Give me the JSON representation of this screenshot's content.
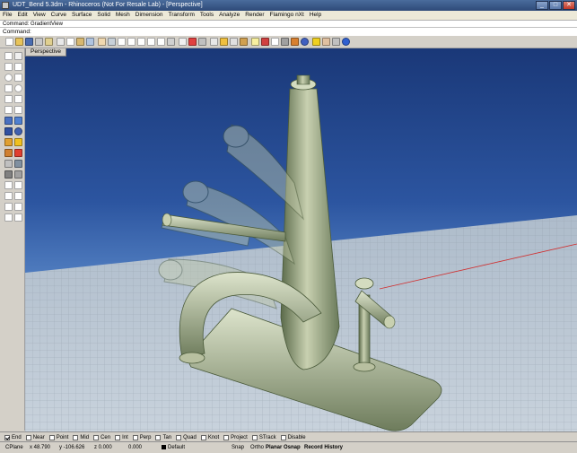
{
  "window": {
    "title": "UDT_Bend 5.3dm - Rhinoceros (Not For Resale Lab) - [Perspective]",
    "minimize": "_",
    "maximize": "□",
    "close": "✕"
  },
  "menu": [
    "File",
    "Edit",
    "View",
    "Curve",
    "Surface",
    "Solid",
    "Mesh",
    "Dimension",
    "Transform",
    "Tools",
    "Analyze",
    "Render",
    "Flamingo nXt",
    "Help"
  ],
  "command": {
    "history": "Command: GradientView",
    "prompt": "Command:"
  },
  "viewport": {
    "tab_label": "Perspective"
  },
  "osnaps": [
    {
      "label": "End",
      "checked": true
    },
    {
      "label": "Near",
      "checked": false
    },
    {
      "label": "Point",
      "checked": false
    },
    {
      "label": "Mid",
      "checked": false
    },
    {
      "label": "Cen",
      "checked": false
    },
    {
      "label": "Int",
      "checked": false
    },
    {
      "label": "Perp",
      "checked": false
    },
    {
      "label": "Tan",
      "checked": false
    },
    {
      "label": "Quad",
      "checked": false
    },
    {
      "label": "Knot",
      "checked": false
    },
    {
      "label": "Project",
      "checked": false
    },
    {
      "label": "STrack",
      "checked": false
    },
    {
      "label": "Disable",
      "checked": false
    }
  ],
  "status": {
    "cplane": "CPlane",
    "x": "x 48.790",
    "y": "y -106.626",
    "z": "z 0.000",
    "extra": "0.000",
    "layer": "Default",
    "snap": "Snap",
    "ortho": "Ortho",
    "planar": "Planar",
    "osnap": "Osnap",
    "record_history": "Record History"
  },
  "colors": {
    "title_bar": "#2e4a78",
    "viewport_top": "#1a3878",
    "viewport_bottom": "#8eb0dc",
    "chrome": "#d4d0c8"
  }
}
